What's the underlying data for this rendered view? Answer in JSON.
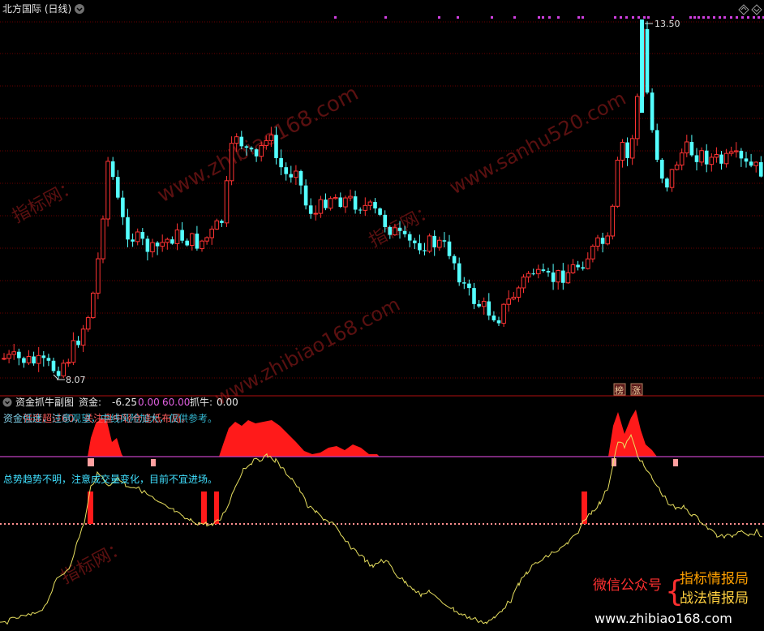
{
  "window": {
    "title": "北方国际 (日线)",
    "colors": {
      "bg": "#000000",
      "up": "#ff3333",
      "down": "#54ffff",
      "grid": "#6a0000",
      "magenta": "#d040d0",
      "yellow": "#e8e060",
      "white": "#ffffff"
    }
  },
  "main_chart": {
    "high_label": "13.50",
    "low_label": "8.07",
    "badges": [
      "榜",
      "涨"
    ]
  },
  "sub_chart": {
    "title": "资金抓牛副图",
    "fund_label": "资金:",
    "fund_value": "-6.25",
    "zero_value": "0.00",
    "sixty_value": "60.00",
    "catch_label": "抓牛:",
    "catch_value": "0.00",
    "overlap_text_line1": "资金强度超过60，关注盘中轻仓逢低布局。",
    "overlap_text_line2": "资金低迷，注意观望，中线风险加大，仅供参考。",
    "trend_text": "总势趋势不明，注意成交量变化，目前不宜进场。"
  },
  "watermarks": [
    "www.zhibiao168.com",
    "指标网：",
    "www.sanhu520.com",
    "指标网：",
    "www.zhibiao168.com",
    "指标网："
  ],
  "promo": {
    "left": "微信公众号",
    "brace": "{",
    "line1": "指标情报局",
    "line2": "战法情报局",
    "url": "www.zhibiao168.com"
  },
  "chart_data": {
    "type": "candlestick",
    "title": "北方国际 (日线)",
    "high": 13.5,
    "low": 8.07,
    "candles_approx": [
      [
        8.3,
        8.4,
        8.45,
        8.25
      ],
      [
        8.35,
        8.3,
        8.4,
        8.2
      ],
      [
        8.3,
        8.45,
        8.5,
        8.25
      ],
      [
        8.4,
        8.35,
        8.5,
        8.3
      ],
      [
        8.35,
        8.25,
        8.4,
        8.15
      ],
      [
        8.25,
        8.3,
        8.4,
        8.2
      ],
      [
        8.3,
        8.2,
        8.35,
        8.1
      ],
      [
        8.2,
        8.3,
        8.35,
        8.1
      ],
      [
        8.3,
        8.15,
        8.35,
        8.07
      ],
      [
        8.15,
        8.3,
        8.4,
        8.1
      ],
      [
        8.3,
        8.45,
        8.5,
        8.25
      ],
      [
        8.45,
        8.4,
        8.5,
        8.3
      ],
      [
        8.4,
        8.9,
        8.95,
        8.35
      ],
      [
        8.9,
        9.3,
        9.4,
        8.85
      ],
      [
        9.3,
        9.9,
        10.0,
        9.2
      ],
      [
        9.9,
        10.6,
        10.7,
        9.8
      ],
      [
        10.6,
        11.4,
        11.5,
        10.5
      ],
      [
        11.5,
        10.8,
        11.6,
        10.7
      ],
      [
        10.8,
        11.1,
        11.2,
        10.6
      ],
      [
        11.1,
        10.6,
        11.2,
        10.5
      ],
      [
        10.6,
        10.3,
        10.7,
        10.2
      ],
      [
        10.3,
        10.5,
        10.6,
        10.2
      ],
      [
        10.5,
        10.2,
        10.6,
        10.1
      ],
      [
        10.2,
        10.4,
        10.5,
        10.1
      ],
      [
        10.4,
        10.3,
        10.5,
        10.2
      ],
      [
        10.3,
        10.5,
        10.6,
        10.2
      ],
      [
        10.5,
        10.4,
        10.6,
        10.3
      ],
      [
        10.4,
        10.3,
        10.5,
        10.2
      ],
      [
        10.3,
        10.6,
        10.7,
        10.2
      ],
      [
        10.6,
        10.4,
        10.7,
        10.3
      ],
      [
        10.4,
        10.6,
        10.7,
        10.3
      ],
      [
        10.6,
        11.0,
        11.1,
        10.5
      ],
      [
        11.0,
        11.6,
        11.8,
        10.9
      ],
      [
        11.6,
        11.4,
        11.7,
        11.2
      ],
      [
        11.4,
        11.2,
        11.6,
        11.1
      ],
      [
        11.2,
        11.6,
        11.8,
        11.1
      ],
      [
        11.6,
        11.3,
        11.8,
        11.2
      ],
      [
        11.3,
        11.1,
        11.4,
        10.9
      ],
      [
        11.1,
        10.8,
        11.2,
        10.6
      ],
      [
        10.8,
        10.6,
        10.9,
        10.4
      ]
    ]
  }
}
